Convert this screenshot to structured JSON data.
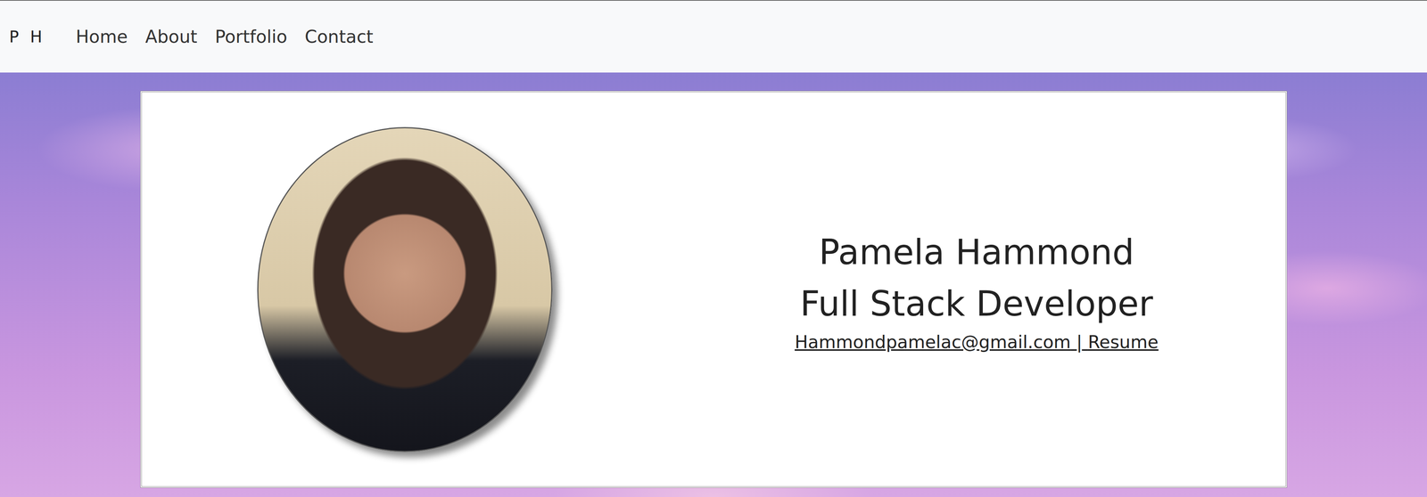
{
  "nav": {
    "brand": "P H",
    "links": [
      {
        "label": "Home"
      },
      {
        "label": "About"
      },
      {
        "label": "Portfolio"
      },
      {
        "label": "Contact"
      }
    ]
  },
  "profile": {
    "name": "Pamela Hammond",
    "title": "Full Stack Developer",
    "email": "Hammondpamelac@gmail.com",
    "separator": "|",
    "resume": "Resume"
  }
}
